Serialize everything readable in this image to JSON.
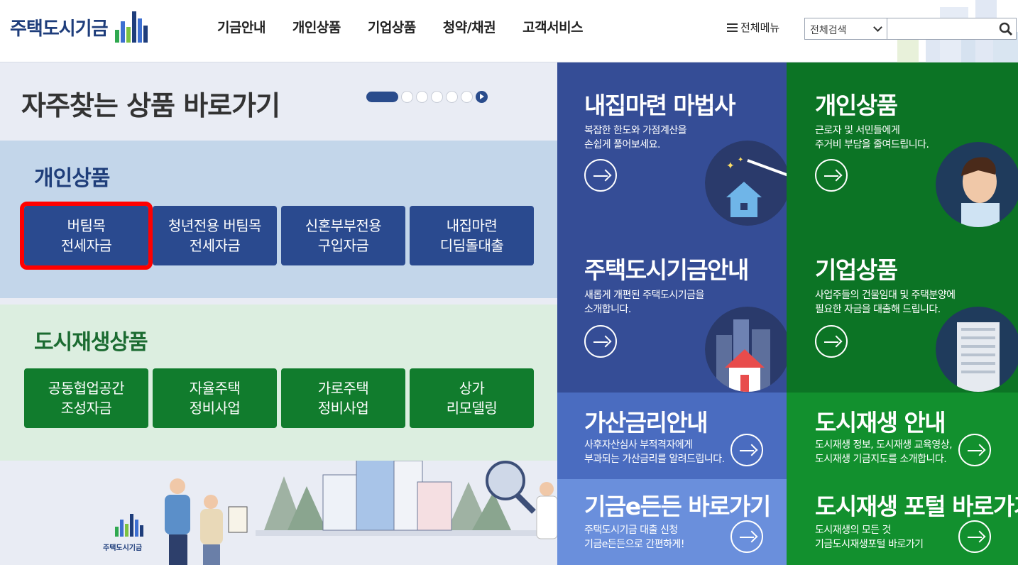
{
  "header": {
    "logo_text": "주택도시기금",
    "nav": [
      "기금안내",
      "개인상품",
      "기업상품",
      "청약/채권",
      "고객서비스"
    ],
    "all_menu_label": "전체메뉴",
    "search": {
      "select_value": "전체검색",
      "input_value": "",
      "button_icon": "search-icon"
    }
  },
  "favorites": {
    "title": "자주찾는 상품 바로가기",
    "pager_count": 6,
    "personal": {
      "title": "개인상품",
      "buttons": [
        "버팀목\n전세자금",
        "청년전용 버팀목\n전세자금",
        "신혼부부전용\n구입자금",
        "내집마련\n디딤돌대출"
      ]
    },
    "urban": {
      "title": "도시재생상품",
      "buttons": [
        "공동협업공간\n조성자금",
        "자율주택\n정비사업",
        "가로주택\n정비사업",
        "상가\n리모델링"
      ]
    },
    "illustration_logo_text": "주택도시기금"
  },
  "tiles": {
    "t1": {
      "title": "내집마련 마법사",
      "desc": "복잡한 한도와 가점계산을\n손쉽게 풀어보세요."
    },
    "t2": {
      "title": "개인상품",
      "desc": "근로자 및 서민들에게\n주거비 부담을 줄여드립니다."
    },
    "t3": {
      "title": "주택도시기금안내",
      "desc": "새롭게 개편된 주택도시기금을\n소개합니다."
    },
    "t4": {
      "title": "기업상품",
      "desc": "사업주들의 건물임대 및 주택분양에\n필요한 자금을 대출해 드립니다."
    },
    "t5": {
      "title": "가산금리안내",
      "desc": "사후자산심사 부적격자에게\n부과되는 가산금리를 알려드립니다."
    },
    "t6": {
      "title": "도시재생 안내",
      "desc": "도시재생 정보, 도시재생 교육영상,\n도시재생 기금지도를 소개합니다."
    },
    "t7": {
      "title": "기금e든든 바로가기",
      "desc": "주택도시기금 대출 신청\n기금e든든으로 간편하게!"
    },
    "t8": {
      "title": "도시재생 포털 바로가기",
      "desc": "도시재생의 모든 것\n기금도시재생포털 바로가기"
    }
  },
  "colors": {
    "brand_blue": "#1e3d7b",
    "tile_blue_dark": "#354d96",
    "tile_blue_mid": "#4a6cc0",
    "tile_blue_light": "#6a8fdc",
    "tile_green_dark": "#0c7425",
    "tile_green": "#12902e",
    "highlight": "#ff0000"
  }
}
